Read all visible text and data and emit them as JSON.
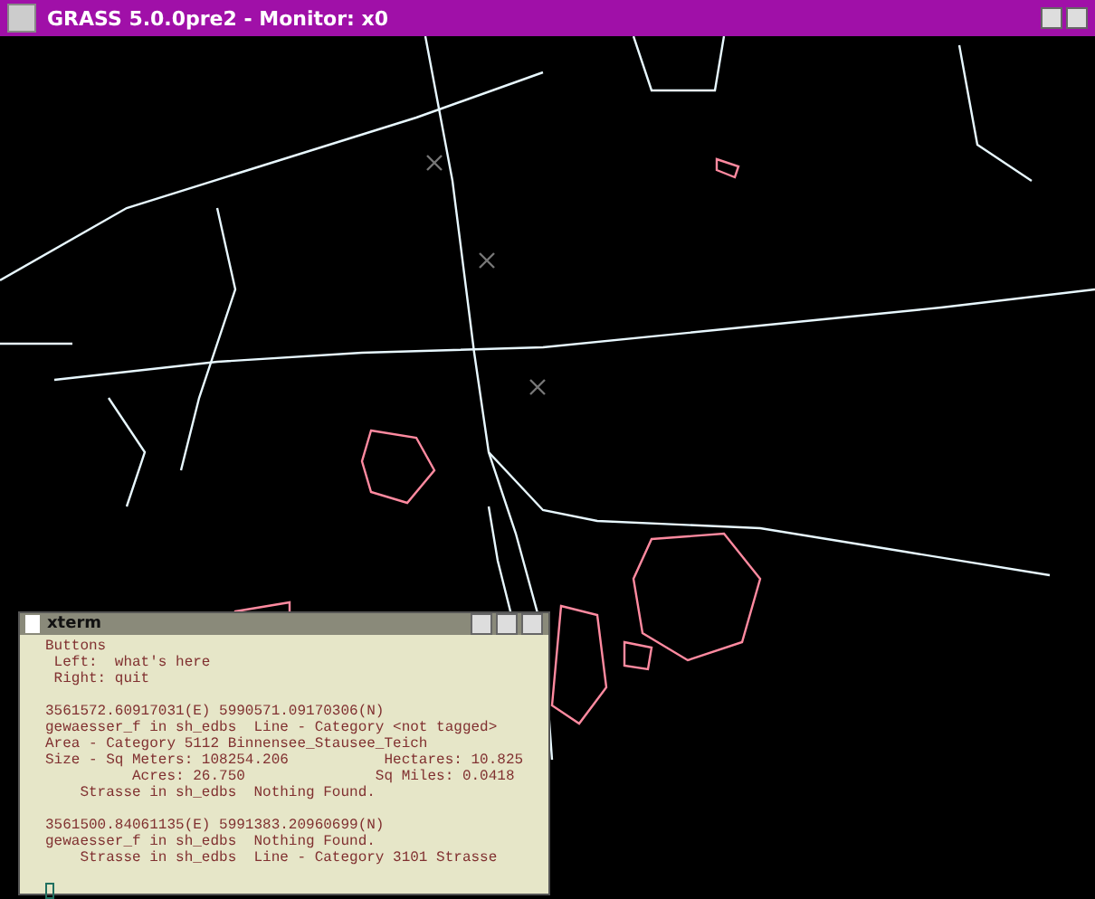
{
  "window": {
    "title": "GRASS 5.0.0pre2 - Monitor: x0"
  },
  "xterm": {
    "title": "xterm",
    "paragraphs": [
      [
        "Buttons",
        " Left:  what's here",
        " Right: quit"
      ],
      [
        "3561572.60917031(E) 5990571.09170306(N)",
        "gewaesser_f in sh_edbs  Line - Category <not tagged>",
        "Area - Category 5112 Binnensee_Stausee_Teich",
        "Size - Sq Meters: 108254.206           Hectares: 10.825",
        "          Acres: 26.750               Sq Miles: 0.0418",
        "    Strasse in sh_edbs  Nothing Found."
      ],
      [
        "3561500.84061135(E) 5991383.20960699(N)",
        "gewaesser_f in sh_edbs  Nothing Found.",
        "    Strasse in sh_edbs  Line - Category 3101 Strasse"
      ]
    ]
  }
}
